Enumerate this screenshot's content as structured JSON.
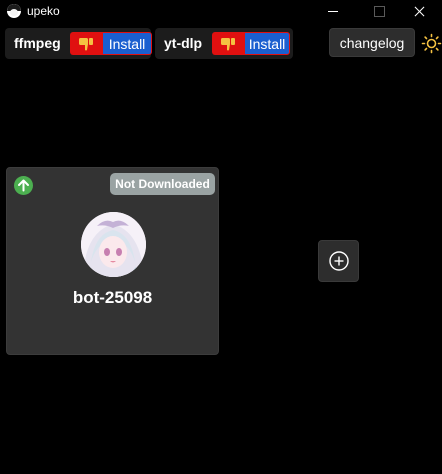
{
  "window": {
    "title": "upeko"
  },
  "dependencies": [
    {
      "name": "ffmpeg",
      "install_label": "Install",
      "status_icon": "thumbs-down-icon"
    },
    {
      "name": "yt-dlp",
      "install_label": "Install",
      "status_icon": "thumbs-down-icon"
    }
  ],
  "toolbar": {
    "changelog_label": "changelog",
    "theme_icon": "sun-icon"
  },
  "bots": [
    {
      "name": "bot-25098",
      "status": "Not Downloaded",
      "update_icon": "arrow-up-icon"
    }
  ],
  "add_button_icon": "plus-circle-icon",
  "colors": {
    "background": "#000000",
    "card": "#333333",
    "install_blue": "#1a5fd0",
    "status_red": "#e01010",
    "badge_gray": "#9aa3a3",
    "update_green": "#4caf50"
  }
}
